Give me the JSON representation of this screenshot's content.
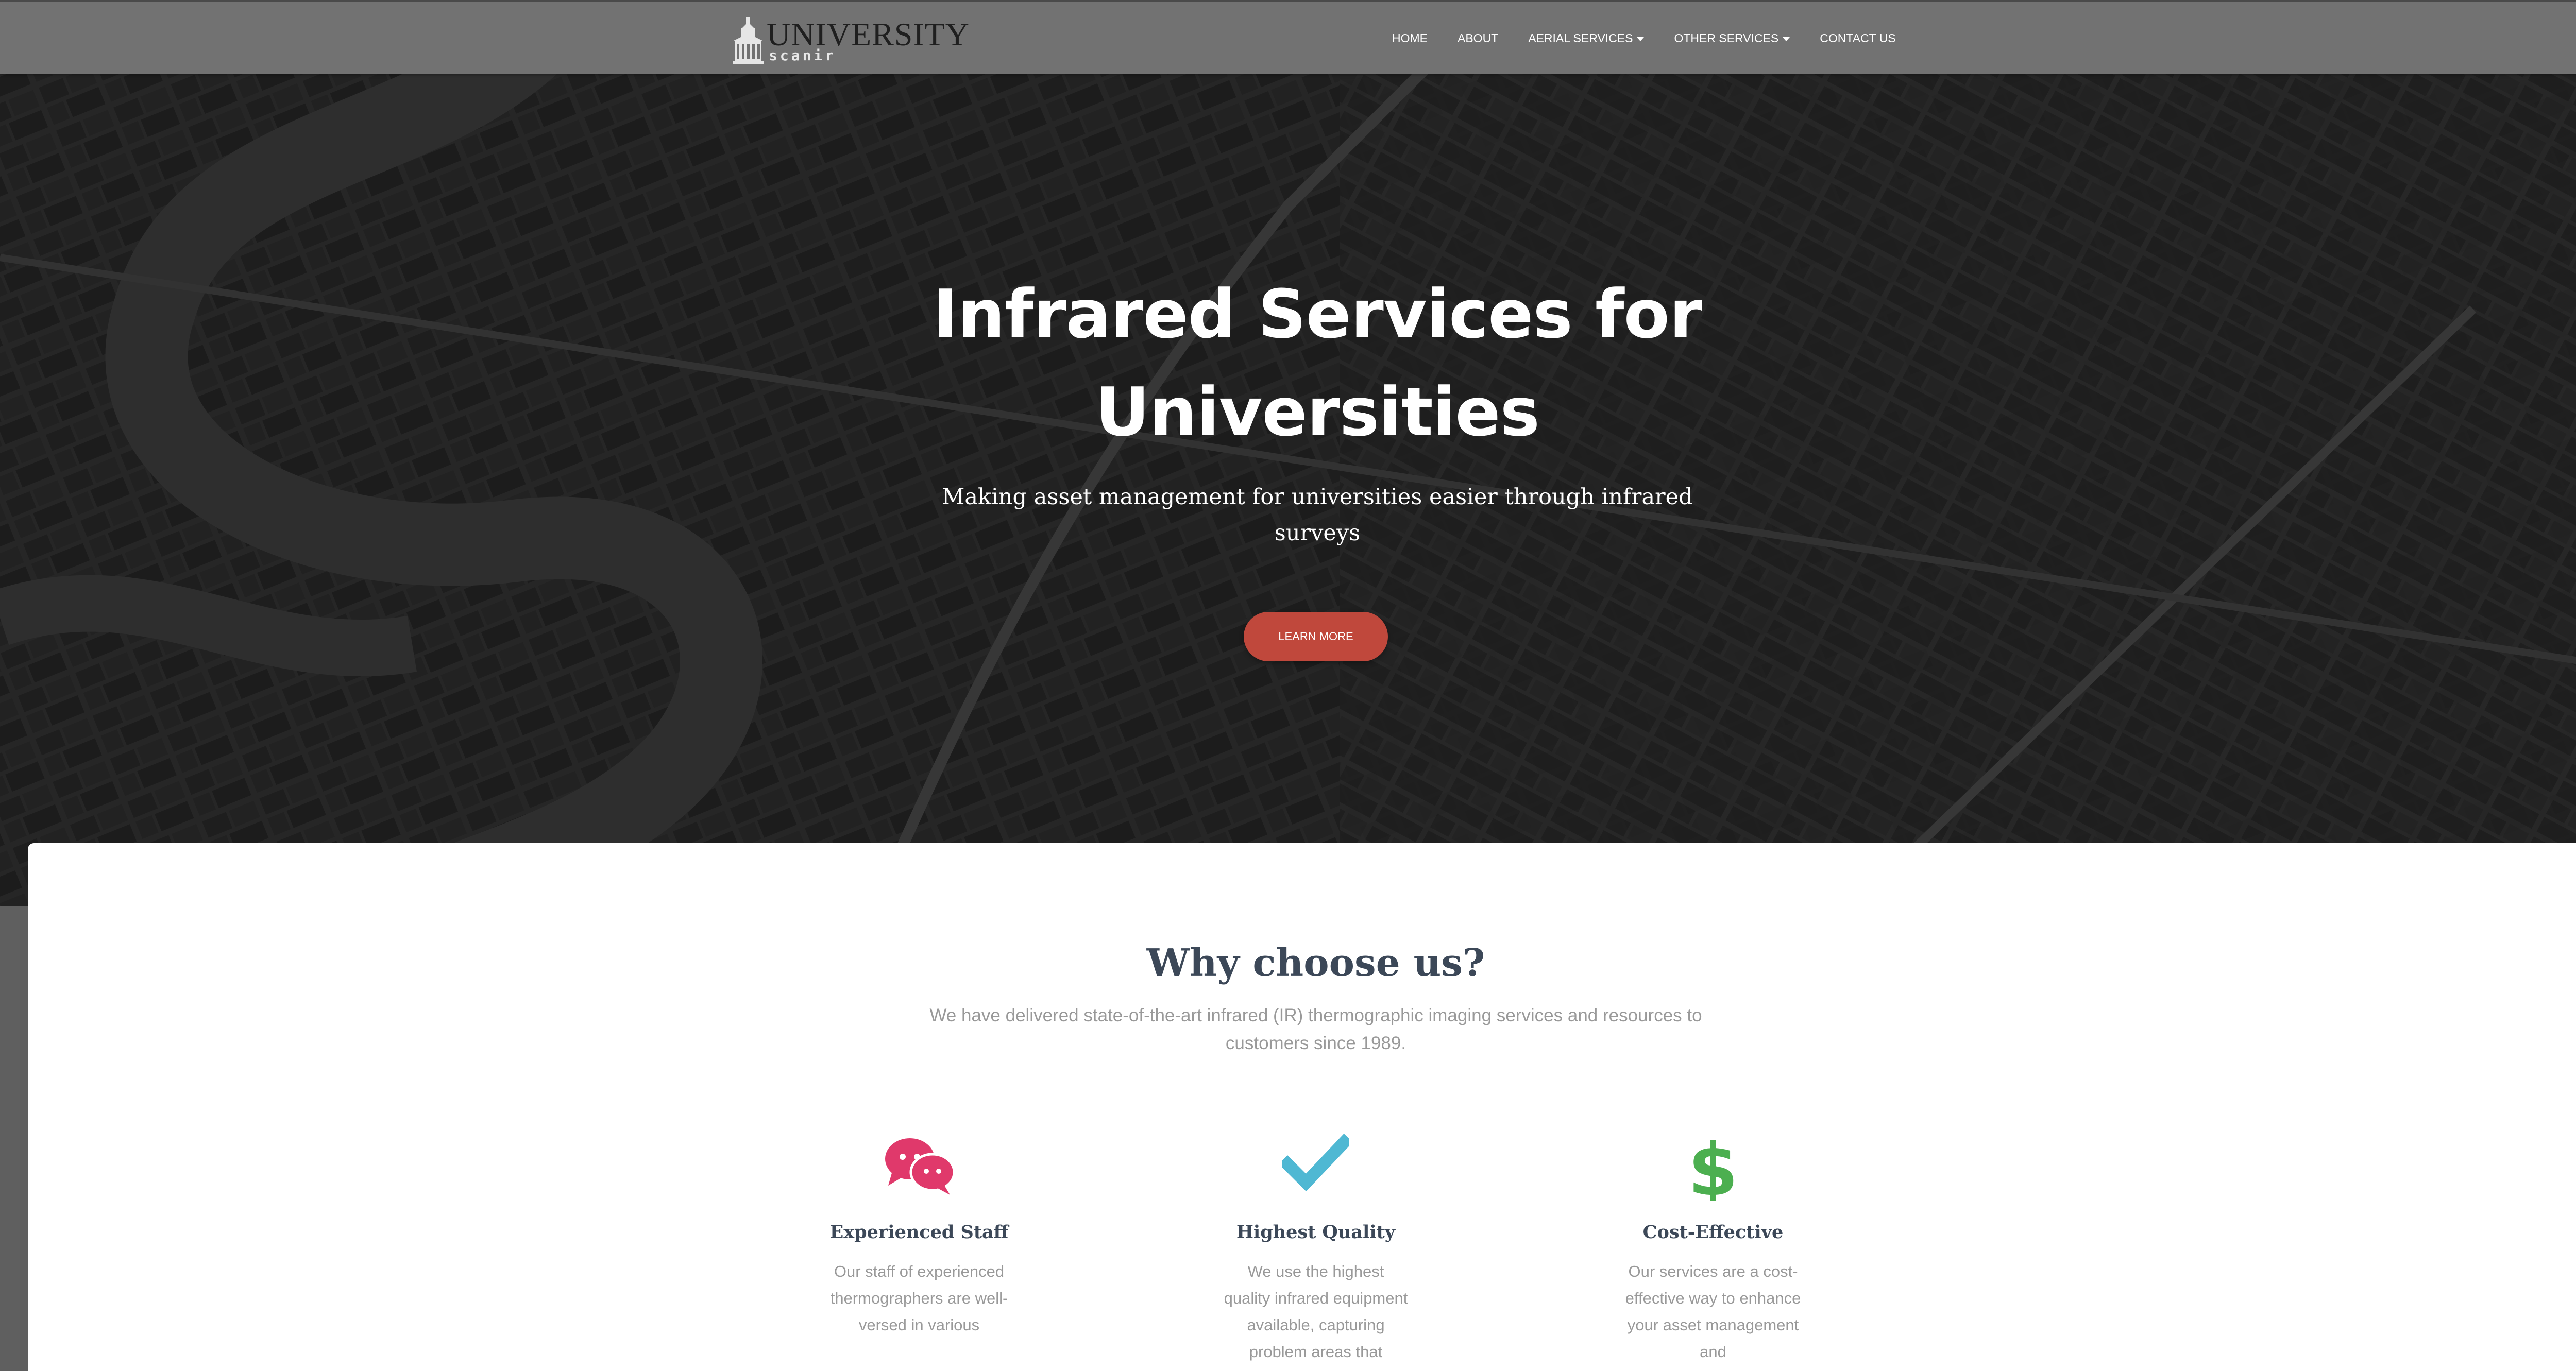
{
  "brand": {
    "name": "UNIVERSITY",
    "sub": "scanir"
  },
  "nav": {
    "items": [
      {
        "label": "HOME",
        "dropdown": false
      },
      {
        "label": "ABOUT",
        "dropdown": false
      },
      {
        "label": "AERIAL SERVICES",
        "dropdown": true
      },
      {
        "label": "OTHER SERVICES",
        "dropdown": true
      },
      {
        "label": "CONTACT US",
        "dropdown": false
      }
    ]
  },
  "hero": {
    "title": "Infrared Services for Universities",
    "subtitle": "Making asset management for universities easier through infrared surveys",
    "cta": "LEARN MORE"
  },
  "why": {
    "title": "Why choose us?",
    "subtitle": "We have delivered state-of-the-art infrared (IR) thermographic imaging services and resources to customers since 1989.",
    "features": [
      {
        "icon": "chat-bubbles-icon",
        "title": "Experienced Staff",
        "desc": "Our staff of experienced thermographers are well-versed in various"
      },
      {
        "icon": "checkmark-icon",
        "title": "Highest Quality",
        "desc": "We use the highest quality infrared equipment available, capturing problem areas that"
      },
      {
        "icon": "dollar-sign-icon",
        "title": "Cost-Effective",
        "desc": "Our services are a cost-effective way to enhance your asset management and"
      }
    ]
  },
  "colors": {
    "accent": "#c0483c",
    "chat": "#e0396b",
    "check": "#4fb8d3",
    "dollar": "#4caf50",
    "heading": "#3c4858",
    "muted": "#999999"
  }
}
